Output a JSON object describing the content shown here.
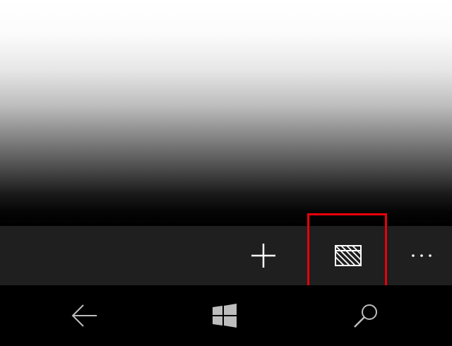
{
  "app_bar": {
    "buttons": [
      {
        "icon": "add-icon"
      },
      {
        "icon": "clapperboard-icon",
        "highlighted": true
      },
      {
        "icon": "more-icon"
      }
    ],
    "highlight_color": "#e8000b",
    "background": "#1f1f1f"
  },
  "nav_bar": {
    "buttons": [
      {
        "icon": "back-arrow-icon"
      },
      {
        "icon": "windows-logo-icon"
      },
      {
        "icon": "search-icon"
      }
    ],
    "background": "#000000"
  },
  "content": {
    "gradient": [
      "#ffffff",
      "#000000"
    ]
  }
}
